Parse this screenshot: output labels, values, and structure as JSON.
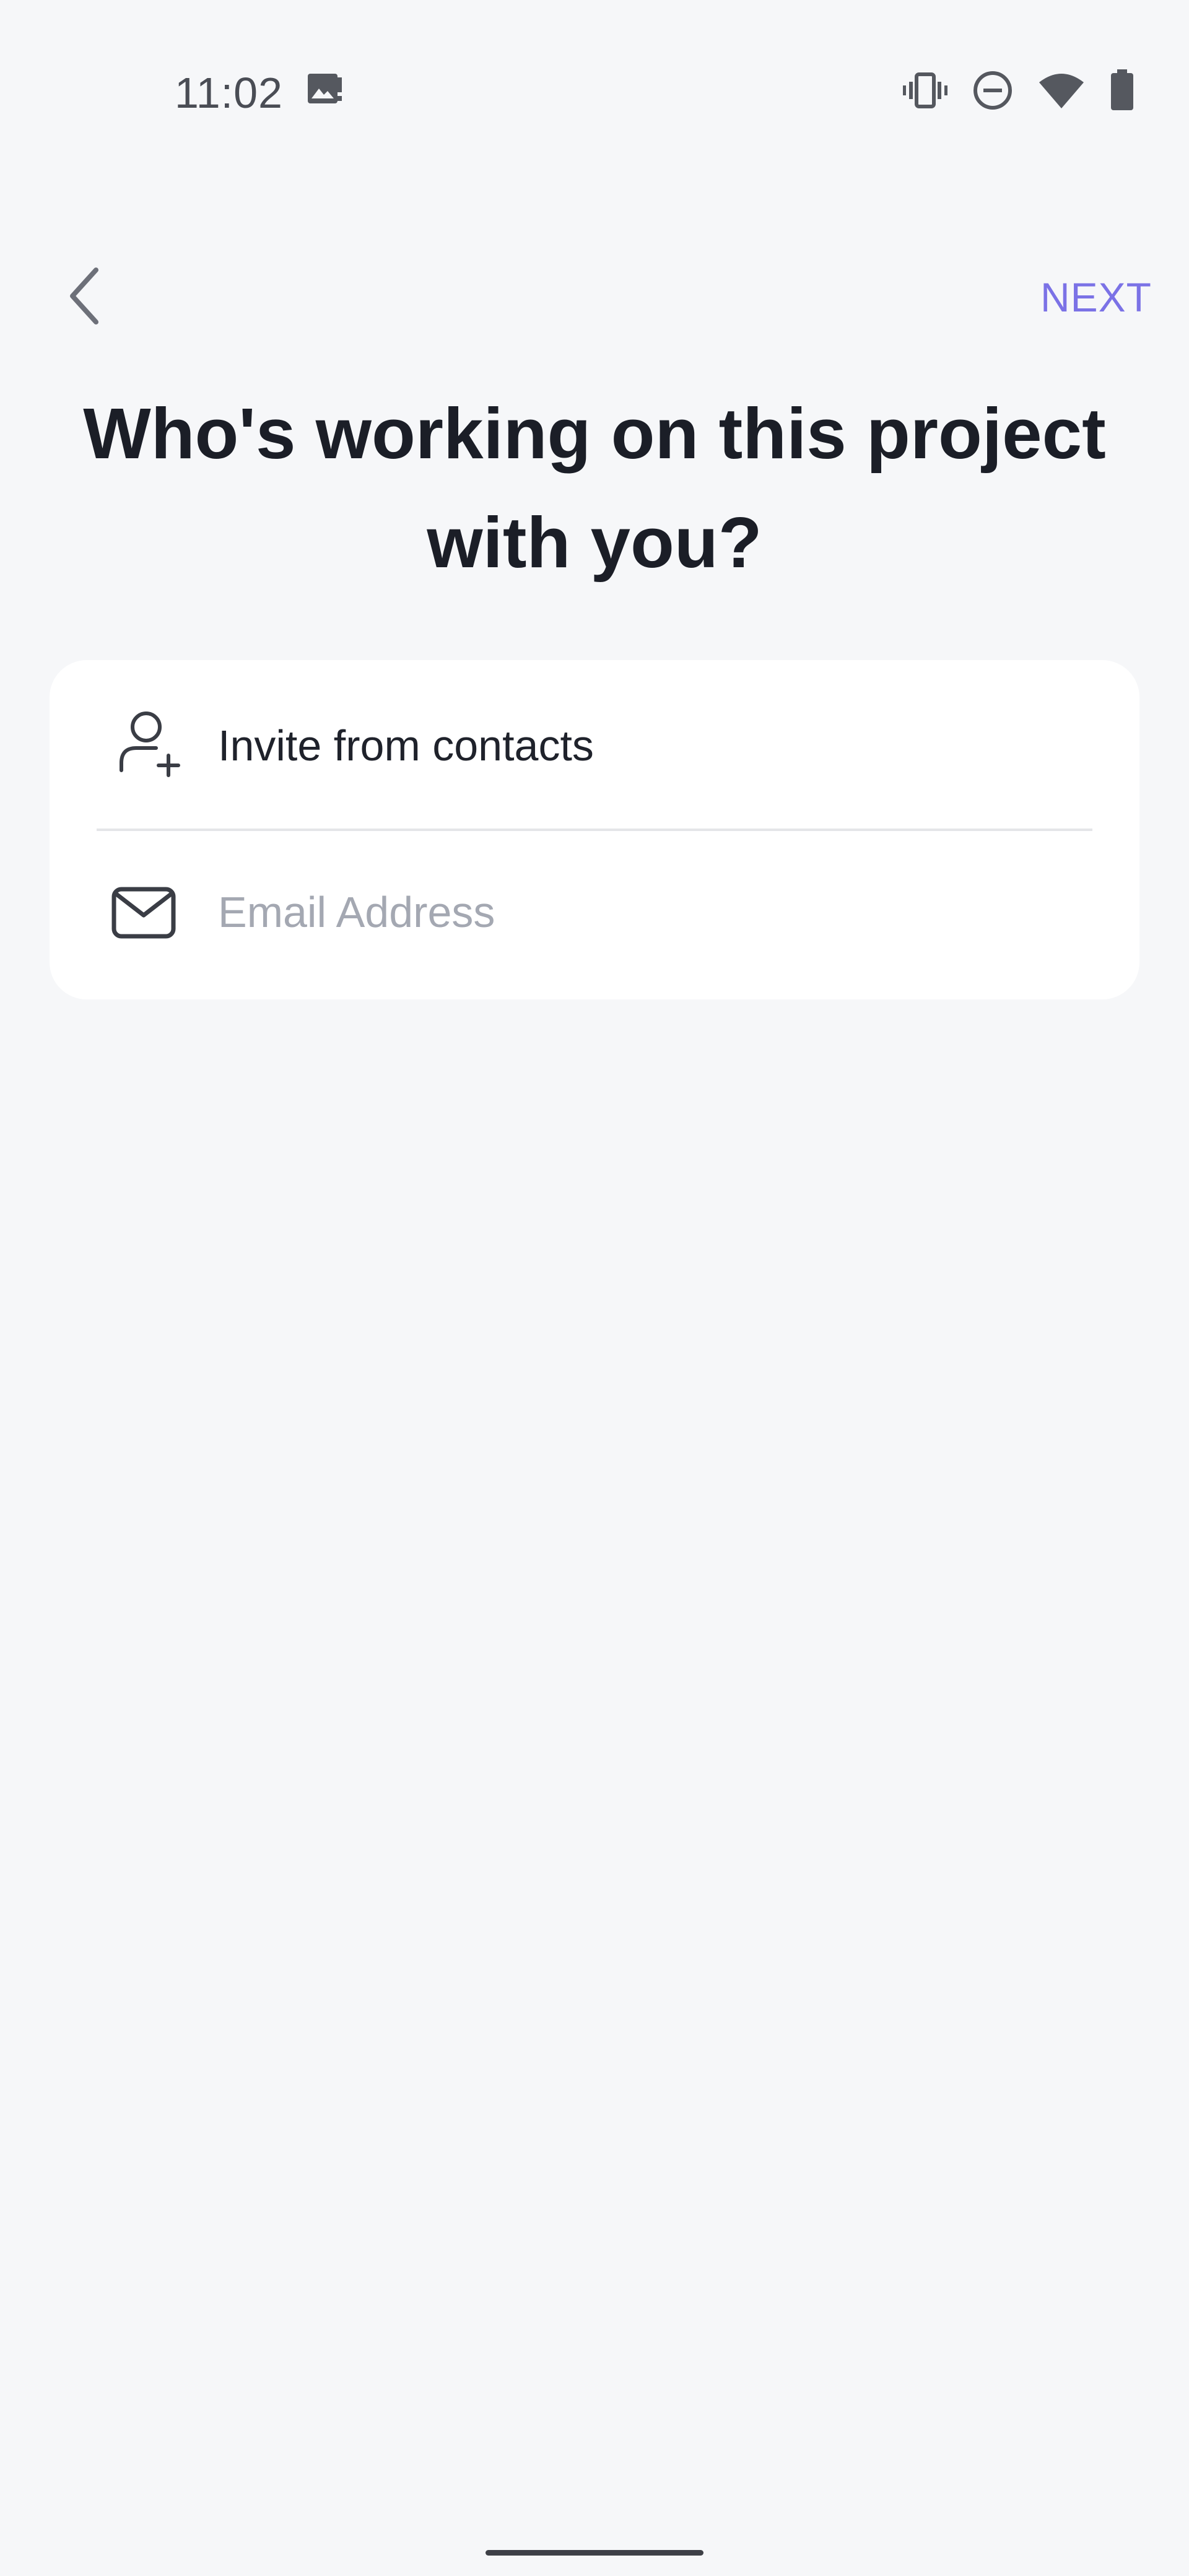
{
  "status_bar": {
    "time": "11:02",
    "icons": [
      "gallery-notification-icon",
      "vibrate-icon",
      "do-not-disturb-icon",
      "wifi-icon",
      "battery-icon"
    ]
  },
  "nav": {
    "back_icon": "chevron-left-icon",
    "next_label": "NEXT"
  },
  "page": {
    "title": "Who's working on this project with you?"
  },
  "invite_card": {
    "contacts_label": "Invite from contacts",
    "contacts_icon": "add-user-icon",
    "email_icon": "envelope-icon",
    "email_placeholder": "Email Address",
    "email_value": ""
  },
  "colors": {
    "accent": "#7B72E6",
    "background": "#F6F7F9",
    "card": "#FFFFFF",
    "title_text": "#1B1E27",
    "placeholder": "#A4A8B2"
  }
}
